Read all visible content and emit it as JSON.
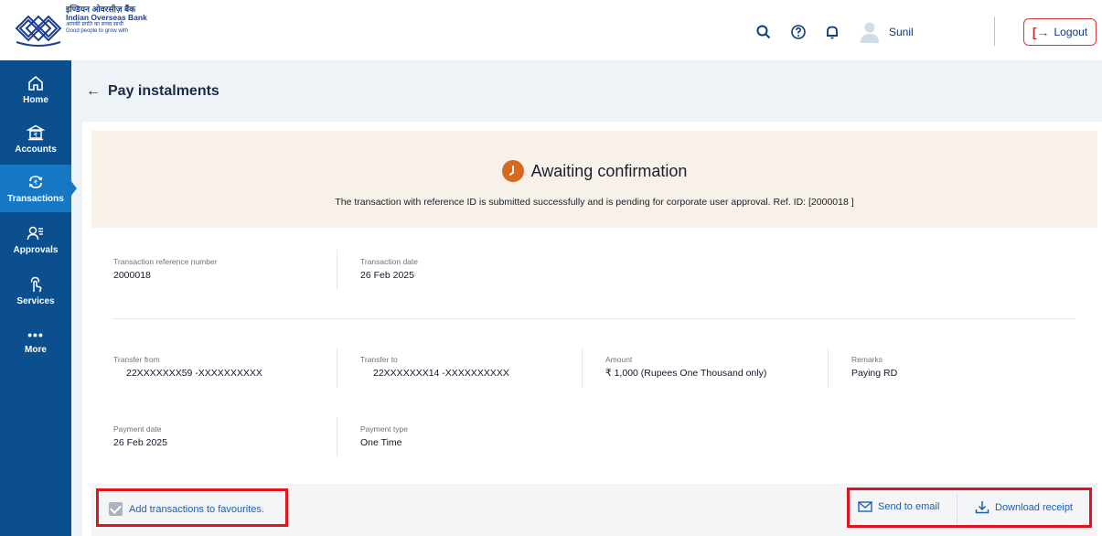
{
  "bank": {
    "hindi_name": "इण्डियन ओवरसीज़ बैंक",
    "name": "Indian Overseas Bank",
    "tagline_hindi": "आपकी प्रगति का सच्चा साथी",
    "tagline": "Good people to grow with"
  },
  "header": {
    "user_name": "Sunil",
    "logout_label": "Logout",
    "icons": [
      "search-icon",
      "help-icon",
      "bell-icon",
      "user-avatar-icon"
    ]
  },
  "sidebar": {
    "items": [
      {
        "label": "Home",
        "icon": "home-icon"
      },
      {
        "label": "Accounts",
        "icon": "bank-icon"
      },
      {
        "label": "Transactions",
        "icon": "transfer-icon",
        "active": true
      },
      {
        "label": "Approvals",
        "icon": "approvals-icon"
      },
      {
        "label": "Services",
        "icon": "services-icon"
      },
      {
        "label": "More",
        "icon": "more-icon"
      }
    ]
  },
  "page": {
    "title": "Pay instalments"
  },
  "status": {
    "title": "Awaiting confirmation",
    "message": "The transaction with reference ID is submitted successfully and is pending for corporate user approval. Ref. ID: [2000018 ]"
  },
  "details": {
    "txn_ref_label": "Transaction reference number",
    "txn_ref_value": "2000018",
    "txn_date_label": "Transaction date",
    "txn_date_value": "26 Feb 2025",
    "from_label": "Transfer from",
    "from_value": "22XXXXXXX59 -XXXXXXXXXX",
    "to_label": "Transfer to",
    "to_value": "22XXXXXXX14 -XXXXXXXXXX",
    "amount_label": "Amount",
    "amount_value": "₹ 1,000 (Rupees One Thousand only)",
    "remarks_label": "Remarks",
    "remarks_value": "Paying RD",
    "pay_date_label": "Payment date",
    "pay_date_value": "26 Feb 2025",
    "pay_type_label": "Payment type",
    "pay_type_value": "One Time"
  },
  "footer": {
    "favourite_label": "Add transactions to favourites.",
    "favourite_checked": true,
    "send_email_label": "Send to email",
    "download_label": "Download receipt"
  },
  "colors": {
    "sidebar": "#0b4f8f",
    "sidebar_active": "#1677c4",
    "status_icon": "#d4691f",
    "link": "#1c5fb0",
    "highlight": "#e0141e"
  }
}
